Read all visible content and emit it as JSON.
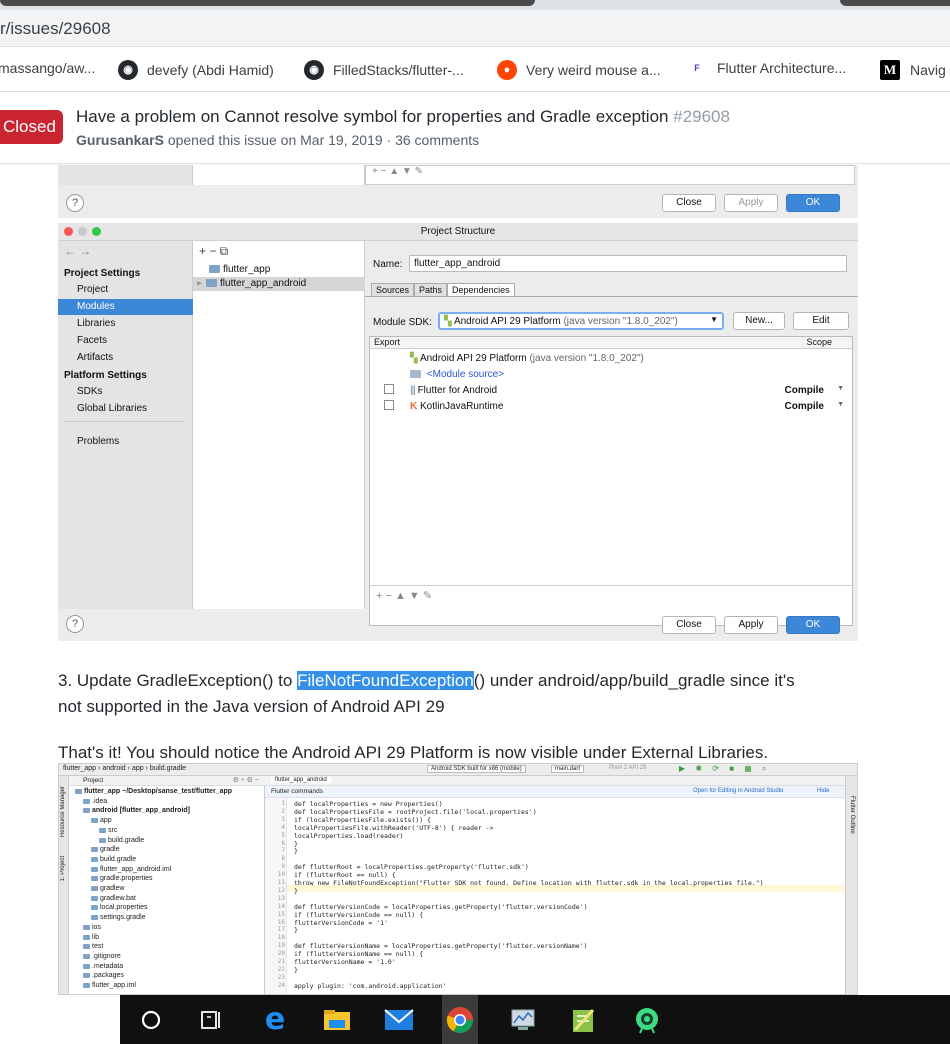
{
  "browser": {
    "address": "r/issues/29608",
    "bookmarks": [
      {
        "label": "massango/aw...",
        "icon": "none"
      },
      {
        "label": "devefy (Abdi Hamid)",
        "icon": "github-icon"
      },
      {
        "label": "FilledStacks/flutter-...",
        "icon": "github-icon"
      },
      {
        "label": "Very weird mouse a...",
        "icon": "reddit-icon"
      },
      {
        "label": "Flutter Architecture...",
        "icon": "flutter-icon"
      },
      {
        "label": "Navig",
        "icon": "medium-icon",
        "icon_text": "M"
      }
    ]
  },
  "issue": {
    "state": "Closed",
    "title": "Have a problem on Cannot resolve symbol for properties and Gradle exception",
    "number": "#29608",
    "author": "GurusankarS",
    "meta": "opened this issue on Mar 19, 2019 · 36 comments"
  },
  "dialog1": {
    "toolbar": "+ − ▲ ▼ ✎",
    "help": "?",
    "close": "Close",
    "apply": "Apply",
    "ok": "OK"
  },
  "dialog2": {
    "title": "Project Structure",
    "nav": "← →",
    "project_settings_header": "Project Settings",
    "project_settings": [
      "Project",
      "Modules",
      "Libraries",
      "Facets",
      "Artifacts"
    ],
    "platform_settings_header": "Platform Settings",
    "platform_settings": [
      "SDKs",
      "Global Libraries"
    ],
    "problems": "Problems",
    "tree_toolbar": "+ − ⧉",
    "tree": [
      "flutter_app",
      "flutter_app_android"
    ],
    "name_label": "Name:",
    "name_value": "flutter_app_android",
    "tabs": [
      "Sources",
      "Paths",
      "Dependencies"
    ],
    "module_sdk_label": "Module SDK:",
    "module_sdk_value": "Android API 29 Platform",
    "module_sdk_java": "(java version \"1.8.0_202\")",
    "new_button": "New...",
    "edit_button": "Edit",
    "col_export": "Export",
    "col_scope": "Scope",
    "deps": [
      {
        "name": "Android API 29 Platform",
        "extra": "(java version \"1.8.0_202\")",
        "scope": "",
        "check": false
      },
      {
        "name": "<Module source>",
        "extra": "",
        "scope": "",
        "check": false
      },
      {
        "name": "Flutter for Android",
        "extra": "",
        "scope": "Compile",
        "check": true
      },
      {
        "name": "KotlinJavaRuntime",
        "extra": "",
        "scope": "Compile",
        "check": true
      }
    ],
    "bottom_toolbar": "+ − ▲ ▼ ✎",
    "help": "?",
    "close": "Close",
    "apply": "Apply",
    "ok": "OK"
  },
  "text": {
    "step3_prefix": "3. Update GradleException() to ",
    "step3_highlight": "FileNotFoundException",
    "step3_suffix": "() under android/app/build_gradle since it's",
    "step3_line2": "not supported in the Java version of Android API 29",
    "thats_it": "That's it! You should notice the Android API 29 Platform is now visible under External Libraries."
  },
  "ide": {
    "breadcrumb": [
      "flutter_app",
      "android",
      "app",
      "build.gradle"
    ],
    "run_config": "Android SDK built for x86 (mobile)",
    "main_dart": "main.dart",
    "pixel": "Pixel 2 API 29",
    "project_label": "Project",
    "editor_tab": "flutter_app_android",
    "flutter_commands": "Flutter commands",
    "open_editing": "Open for Editing in Android Studio",
    "hide": "Hide",
    "side_labels": [
      "Resource Manager",
      "1: Project"
    ],
    "right_label": "Flutter Outline",
    "tree": [
      {
        "text": "flutter_app ~/Desktop/sanse_test/flutter_app",
        "indent": 0
      },
      {
        "text": ".idea",
        "indent": 1
      },
      {
        "text": "android [flutter_app_android]",
        "indent": 1
      },
      {
        "text": "app",
        "indent": 2
      },
      {
        "text": "src",
        "indent": 3
      },
      {
        "text": "build.gradle",
        "indent": 3
      },
      {
        "text": "gradle",
        "indent": 2
      },
      {
        "text": "build.gradle",
        "indent": 2
      },
      {
        "text": "flutter_app_android.iml",
        "indent": 2
      },
      {
        "text": "gradle.properties",
        "indent": 2
      },
      {
        "text": "gradlew",
        "indent": 2
      },
      {
        "text": "gradlew.bat",
        "indent": 2
      },
      {
        "text": "local.properties",
        "indent": 2
      },
      {
        "text": "settings.gradle",
        "indent": 2
      },
      {
        "text": "ios",
        "indent": 1
      },
      {
        "text": "lib",
        "indent": 1
      },
      {
        "text": "test",
        "indent": 1
      },
      {
        "text": ".gitignore",
        "indent": 1
      },
      {
        "text": ".metadata",
        "indent": 1
      },
      {
        "text": ".packages",
        "indent": 1
      },
      {
        "text": "flutter_app.iml",
        "indent": 1
      }
    ],
    "code": [
      "def localProperties = new Properties()",
      "def localPropertiesFile = rootProject.file('local.properties')",
      "if (localPropertiesFile.exists()) {",
      "    localPropertiesFile.withReader('UTF-8') { reader ->",
      "        localProperties.load(reader)",
      "    }",
      "}",
      "",
      "def flutterRoot = localProperties.getProperty('flutter.sdk')",
      "if (flutterRoot == null) {",
      "    throw new FileNotFoundException(\"Flutter SDK not found. Define location with flutter.sdk in the local.properties file.\")",
      "}",
      "",
      "def flutterVersionCode = localProperties.getProperty('flutter.versionCode')",
      "if (flutterVersionCode == null) {",
      "    flutterVersionCode = '1'",
      "}",
      "",
      "def flutterVersionName = localProperties.getProperty('flutter.versionName')",
      "if (flutterVersionName == null) {",
      "    flutterVersionName = '1.0'",
      "}",
      "",
      "apply plugin: 'com.android.application'"
    ]
  },
  "taskbar": {
    "icons": [
      "cortana-icon",
      "task-view-icon",
      "edge-icon",
      "file-explorer-icon",
      "mail-icon",
      "chrome-icon",
      "network-icon",
      "notepad-icon",
      "android-studio-icon"
    ]
  },
  "colors": {
    "closed_badge": "#cb2431",
    "selection_blue": "#3390e6",
    "ide_ok_button": "#3d87d8",
    "taskbar": "#101010"
  }
}
